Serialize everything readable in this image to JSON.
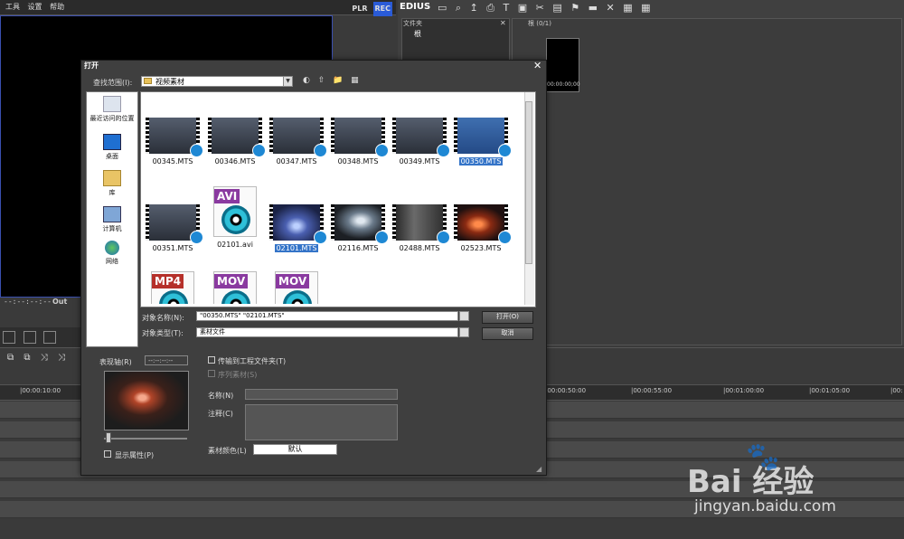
{
  "menubar": {
    "items": [
      "工具",
      "设置",
      "帮助"
    ],
    "plr": "PLR",
    "rec": "REC"
  },
  "player": {
    "tc_left": "--:--:--:--",
    "out_label": "Out"
  },
  "bin": {
    "app_title": "EDIUS",
    "toolbar_glyphs": "▭ ⌕ ↥ ⎙ T ▣ ✂ ▤ ⚑ ▬ ✕ ▦ ▦",
    "folder_header": "文件夹",
    "folder_root": "根",
    "clip_header": "根 (0/1)",
    "clip_tc": "00:00:00;00"
  },
  "timeline": {
    "tools_glyphs": "⧉ ⧉ ⤨ ⤨",
    "ticks": [
      "|00:00:10:00",
      "|00:00:50:00",
      "|00:00:55:00",
      "|00:01:00:00",
      "|00:01:05:00",
      "|00:"
    ]
  },
  "dialog": {
    "title": "打开",
    "close": "✕",
    "lookin_label": "查找范围(I):",
    "lookin_value": "视频素材",
    "nav_icons": "◐ ⇧ 📁 ▦",
    "places": [
      {
        "label": "最近访问的位置",
        "icon": "recent-places-icon"
      },
      {
        "label": "桌面",
        "icon": "desktop-icon"
      },
      {
        "label": "库",
        "icon": "library-icon"
      },
      {
        "label": "计算机",
        "icon": "computer-icon"
      },
      {
        "label": "网络",
        "icon": "network-icon"
      }
    ],
    "files": [
      {
        "name": "00345.MTS",
        "kind": "video"
      },
      {
        "name": "00346.MTS",
        "kind": "video"
      },
      {
        "name": "00347.MTS",
        "kind": "video"
      },
      {
        "name": "00348.MTS",
        "kind": "video"
      },
      {
        "name": "00349.MTS",
        "kind": "video"
      },
      {
        "name": "00350.MTS",
        "kind": "video",
        "selected": true
      },
      {
        "name": "00351.MTS",
        "kind": "video"
      },
      {
        "name": "02101.avi",
        "kind": "doc",
        "tag": "AVI"
      },
      {
        "name": "02101.MTS",
        "kind": "video",
        "selected": true
      },
      {
        "name": "02116.MTS",
        "kind": "video"
      },
      {
        "name": "02488.MTS",
        "kind": "video"
      },
      {
        "name": "02523.MTS",
        "kind": "video"
      },
      {
        "name": "",
        "kind": "doc",
        "tag": "MP4"
      },
      {
        "name": "",
        "kind": "doc",
        "tag": "MOV"
      },
      {
        "name": "",
        "kind": "doc",
        "tag": "MOV"
      }
    ],
    "name_label": "对象名称(N):",
    "name_value": "\"00350.MTS\" \"02101.MTS\"",
    "type_label": "对象类型(T):",
    "type_value": "素材文件",
    "open_button": "打开(O)",
    "cancel_button": "取消",
    "preview_label": "表现轴(R)",
    "preview_tc": "--:--:--:--",
    "show_props": "显示属性(P)",
    "transfer_label": "传输到工程文件夹(T)",
    "seq_label": "序列素材(S)",
    "clipname_label": "名称(N)",
    "comment_label": "注释(C)",
    "color_label": "素材颜色(L)",
    "color_value": "默认"
  },
  "watermark": {
    "logo": "Bai  经验",
    "url": "jingyan.baidu.com"
  }
}
